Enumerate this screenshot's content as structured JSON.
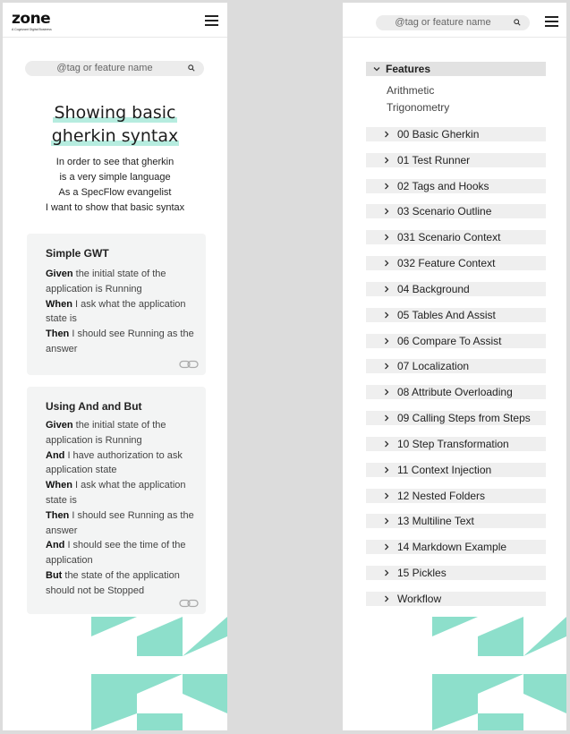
{
  "brand": {
    "name": "zone",
    "tagline": "A Cognizant Digital Business"
  },
  "search": {
    "placeholder": "@tag or feature name"
  },
  "feature": {
    "title_lines": [
      "Showing basic",
      "gherkin syntax"
    ],
    "description_lines": [
      "In order to see that gherkin",
      "is a very simple language",
      "As a SpecFlow evangelist",
      "I want to show that basic syntax"
    ]
  },
  "scenarios": [
    {
      "title": "Simple GWT",
      "steps": [
        {
          "keyword": "Given",
          "text": " the initial state of the application is Running"
        },
        {
          "keyword": "When",
          "text": " I ask what the application state is"
        },
        {
          "keyword": "Then",
          "text": " I should see Running as the answer"
        }
      ]
    },
    {
      "title": "Using And and But",
      "steps": [
        {
          "keyword": "Given",
          "text": " the initial state of the application is Running"
        },
        {
          "keyword": "And",
          "text": " I have authorization to ask application state"
        },
        {
          "keyword": "When",
          "text": " I ask what the application state is"
        },
        {
          "keyword": "Then",
          "text": " I should see Running as the answer"
        },
        {
          "keyword": "And",
          "text": " I should see the time of the application"
        },
        {
          "keyword": "But",
          "text": " the state of the application should not be Stopped"
        }
      ]
    }
  ],
  "navigation": {
    "root": "Features",
    "expanded_children": [
      "Arithmetic",
      "Trigonometry"
    ],
    "items": [
      "00 Basic Gherkin",
      "01 Test Runner",
      "02 Tags and Hooks",
      "03 Scenario Outline",
      "031 Scenario Context",
      "032 Feature Context",
      "04 Background",
      "05 Tables And Assist",
      "06 Compare To Assist",
      "07 Localization",
      "08 Attribute Overloading",
      "09 Calling Steps from Steps",
      "10 Step Transformation",
      "11 Context Injection",
      "12 Nested Folders",
      "13 Multiline Text",
      "14 Markdown Example",
      "15 Pickles",
      "Workflow"
    ]
  },
  "colors": {
    "accent": "#8ddfcb",
    "highlight": "#b6ecdf",
    "card_bg": "#f3f4f4",
    "tree_row_bg": "#efefef"
  },
  "icons": {
    "menu": "hamburger-icon",
    "search": "search-icon",
    "link": "link-icon",
    "expand": "chevron-right-icon",
    "collapse": "chevron-down-icon"
  }
}
